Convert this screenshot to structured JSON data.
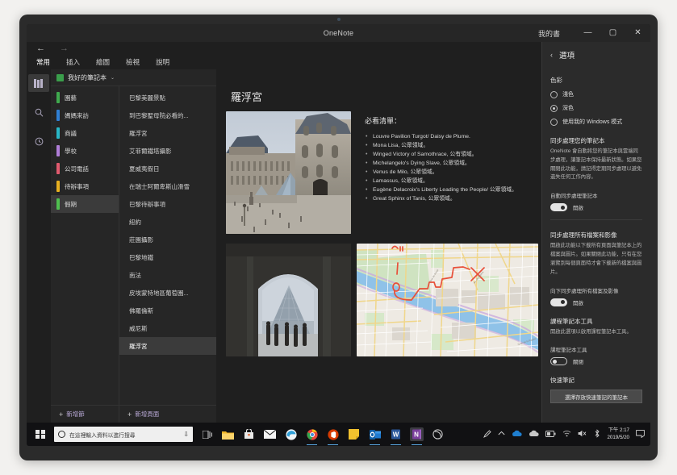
{
  "window": {
    "app_title": "OneNote",
    "account_title": "我的書",
    "minimize": "—",
    "maximize": "▢",
    "close": "✕"
  },
  "ribbon": {
    "back_icon": "back-arrow",
    "forward_icon": "forward-arrow",
    "tabs": [
      {
        "label": "常用",
        "active": true
      },
      {
        "label": "插入",
        "active": false
      },
      {
        "label": "繪圖",
        "active": false
      },
      {
        "label": "檢視",
        "active": false
      },
      {
        "label": "說明",
        "active": false
      }
    ]
  },
  "rail": {
    "items": [
      {
        "name": "notebooks-icon",
        "glyph": "▥",
        "active": true
      },
      {
        "name": "search-icon",
        "glyph": "⌕",
        "active": false
      },
      {
        "name": "recent-icon",
        "glyph": "◷",
        "active": false
      }
    ]
  },
  "navpane": {
    "notebook_name": "我好的筆記本",
    "notebook_chevron": "⌄",
    "sections": [
      {
        "label": "園藝",
        "color": "#3faa4e",
        "selected": false
      },
      {
        "label": "媽媽來訪",
        "color": "#2f7fd4",
        "selected": false
      },
      {
        "label": "商議",
        "color": "#28b6c6",
        "selected": false
      },
      {
        "label": "學校",
        "color": "#b07ed8",
        "selected": false
      },
      {
        "label": "公司電話",
        "color": "#e05a6e",
        "selected": false
      },
      {
        "label": "待辦事項",
        "color": "#e8b020",
        "selected": false
      },
      {
        "label": "假期",
        "color": "#4fbf4f",
        "selected": true
      }
    ],
    "pages": [
      {
        "label": "巴黎美麗景點",
        "selected": false
      },
      {
        "label": "到巴黎聖母院必看的...",
        "selected": false
      },
      {
        "label": "羅浮宮",
        "selected": false
      },
      {
        "label": "艾菲爾鐵塔攝影",
        "selected": false
      },
      {
        "label": "夏威夷假日",
        "selected": false
      },
      {
        "label": "在瑞士阿爾卑斯山滑雪",
        "selected": false
      },
      {
        "label": "巴黎待辦事項",
        "selected": false
      },
      {
        "label": "紐約",
        "selected": false
      },
      {
        "label": "莊園攝影",
        "selected": false
      },
      {
        "label": "巴黎地鐵",
        "selected": false
      },
      {
        "label": "南法",
        "selected": false
      },
      {
        "label": "皮埃蒙特地區葡萄園...",
        "selected": false
      },
      {
        "label": "佛羅倫斯",
        "selected": false
      },
      {
        "label": "威尼斯",
        "selected": false
      },
      {
        "label": "羅浮宮",
        "selected": true
      }
    ],
    "add_section_label": "新增節",
    "add_page_label": "新增頁面",
    "plus_glyph": "+"
  },
  "canvas": {
    "page_title": "羅浮宮",
    "list_heading": "必看清單：",
    "bullets": [
      "Louvre Pavilion Turgot/ Daisy de Plume.",
      "Mona Lisa, 公眾領域。",
      "Winged Victory of Samothrace, 公有領域。",
      "Michelangelo's Dying Slave, 公眾領域。",
      "Venus de Milo, 公眾領域。",
      "Lamassus, 公眾領域。",
      "Eugène Delacroix's Liberty Leading the People/ 公眾領域。",
      "Great Sphinx of Tanis, 公眾領域。"
    ],
    "images": [
      {
        "name": "louvre-courtyard-photo",
        "alt": "Louvre palace courtyard with pyramid"
      },
      {
        "name": "louvre-pyramid-archway-photo",
        "alt": "View of Louvre pyramid through archway"
      },
      {
        "name": "paris-map-with-ink",
        "alt": "Paris map with red ink annotations"
      }
    ]
  },
  "settings": {
    "back_glyph": "‹",
    "title": "選項",
    "color_section": "色彩",
    "color_options": [
      {
        "label": "淺色",
        "selected": false
      },
      {
        "label": "深色",
        "selected": true
      },
      {
        "label": "使用我的 Windows 模式",
        "selected": false
      }
    ],
    "sync_heading": "同步處理您的筆記本",
    "sync_desc": "OneNote 會自動將您的筆記本與雲端同步處理，讓筆記本保持最新狀態。如果您關閉此功能，請記得定期同步處理以避免遺失任何工作內容。",
    "auto_sync_label": "自動同步處理筆記本",
    "auto_sync_state": "開啟",
    "files_heading": "同步處理所有檔案和影像",
    "files_desc": "開啟此功能以下載所有頁面與筆記本上的檔案與圖片。如果關閉此功能，只有在您瀏覽到每個頁面時才會下載新的檔案與圖片。",
    "download_label": "向下同步處理所有檔案及影像",
    "download_state": "開啟",
    "class_heading": "課程筆記本工具",
    "class_desc": "開啟此選項以啟用課程筆記本工具。",
    "class_label": "課程筆記本工具",
    "class_state": "關閉",
    "quick_heading": "快速筆記",
    "quick_button": "選擇存放快速筆記的筆記本"
  },
  "taskbar": {
    "start_name": "start-button",
    "search_placeholder": "在這裡輸入資料以進行搜尋",
    "mic_glyph": "⇩",
    "taskview_glyph": "❐",
    "apps": [
      {
        "name": "file-explorer-icon",
        "glyph": "",
        "color": "#f0b429",
        "active": false,
        "running": false
      },
      {
        "name": "microsoft-store-icon",
        "glyph": "",
        "color": "#d8d8d8",
        "active": false,
        "running": false
      },
      {
        "name": "mail-icon",
        "glyph": "✉",
        "color": "#ffffff",
        "active": false,
        "running": false
      },
      {
        "name": "edge-icon",
        "glyph": "e",
        "color": "#2f9fd8",
        "active": false,
        "running": false
      },
      {
        "name": "chrome-icon",
        "glyph": "",
        "color": "#e8453c",
        "active": false,
        "running": true
      },
      {
        "name": "office-icon",
        "glyph": "",
        "color": "#d83b01",
        "active": false,
        "running": true
      },
      {
        "name": "sticky-notes-icon",
        "glyph": "",
        "color": "#f2c12e",
        "active": false,
        "running": false
      },
      {
        "name": "outlook-icon",
        "glyph": "O",
        "color": "#0f6cbd",
        "active": false,
        "running": true
      },
      {
        "name": "word-icon",
        "glyph": "W",
        "color": "#2b579a",
        "active": false,
        "running": true
      },
      {
        "name": "onenote-icon",
        "glyph": "N",
        "color": "#7a3e9d",
        "active": true,
        "running": true
      },
      {
        "name": "cortana-icon",
        "glyph": "◯",
        "color": "#c9c9c9",
        "active": false,
        "running": false
      }
    ],
    "tray": [
      {
        "name": "pen-tray-icon",
        "glyph": "✒"
      },
      {
        "name": "show-hidden-icons-chevron",
        "glyph": "^"
      },
      {
        "name": "onedrive-icon",
        "glyph": "☁"
      },
      {
        "name": "onedrive-personal-icon",
        "glyph": "☁"
      },
      {
        "name": "battery-icon",
        "glyph": "▭"
      },
      {
        "name": "network-icon",
        "glyph": "⚡"
      },
      {
        "name": "volume-icon",
        "glyph": "🔊"
      },
      {
        "name": "bluetooth-icon",
        "glyph": "✜"
      }
    ],
    "clock_time": "下午 2:17",
    "clock_date": "2019/5/20",
    "action_center_glyph": "▢"
  }
}
